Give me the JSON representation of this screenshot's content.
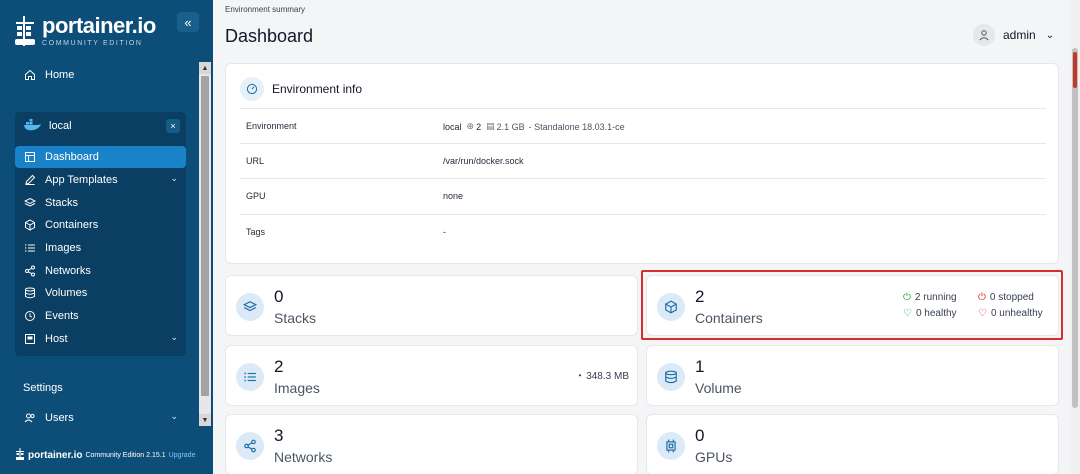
{
  "brand": {
    "title": "portainer.io",
    "subtitle": "COMMUNITY EDITION"
  },
  "sidebar": {
    "home": "Home",
    "environment": "local",
    "env_close": "×",
    "items": [
      {
        "label": "Dashboard",
        "icon": "dashboard-icon",
        "active": true
      },
      {
        "label": "App Templates",
        "icon": "edit-icon",
        "expandable": true
      },
      {
        "label": "Stacks",
        "icon": "layers-icon"
      },
      {
        "label": "Containers",
        "icon": "box-icon"
      },
      {
        "label": "Images",
        "icon": "list-icon"
      },
      {
        "label": "Networks",
        "icon": "share-icon"
      },
      {
        "label": "Volumes",
        "icon": "database-icon"
      },
      {
        "label": "Events",
        "icon": "history-icon"
      },
      {
        "label": "Host",
        "icon": "server-icon",
        "expandable": true
      }
    ],
    "settings_heading": "Settings",
    "users": "Users",
    "footer": {
      "brand": "portainer.io",
      "edition": "Community Edition 2.15.1",
      "upgrade": "Upgrade"
    }
  },
  "header": {
    "breadcrumb": "Environment summary",
    "title": "Dashboard",
    "user": "admin"
  },
  "env_info": {
    "title": "Environment info",
    "rows": [
      {
        "key": "Environment",
        "value": "local",
        "cpu": "2",
        "memory": "2.1 GB",
        "detail": "- Standalone 18.03.1-ce"
      },
      {
        "key": "URL",
        "value": "/var/run/docker.sock"
      },
      {
        "key": "GPU",
        "value": "none"
      },
      {
        "key": "Tags",
        "value": "-"
      }
    ]
  },
  "stats": {
    "stacks": {
      "value": "0",
      "label": "Stacks"
    },
    "containers": {
      "value": "2",
      "label": "Containers",
      "running": "2 running",
      "stopped": "0 stopped",
      "healthy": "0 healthy",
      "unhealthy": "0 unhealthy"
    },
    "images": {
      "value": "2",
      "label": "Images",
      "size": "348.3 MB"
    },
    "volume": {
      "value": "1",
      "label": "Volume"
    },
    "networks": {
      "value": "3",
      "label": "Networks"
    },
    "gpus": {
      "value": "0",
      "label": "GPUs"
    }
  },
  "colors": {
    "sidebar": "#0d4e79",
    "accent": "#1a82c8",
    "running": "#22a34a",
    "stopped": "#dc2626",
    "highlight": "#d62d2d"
  }
}
